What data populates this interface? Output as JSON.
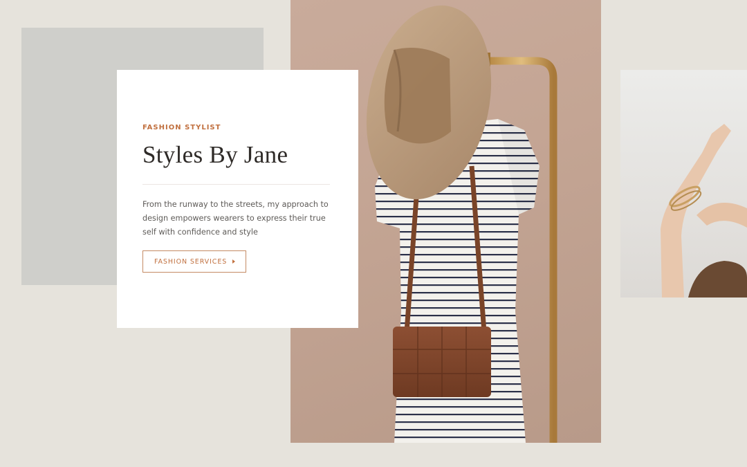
{
  "hero": {
    "eyebrow": "FASHION STYLIST",
    "title": "Styles By Jane",
    "description": "From the runway to the streets, my approach to design empowers wearers to express their true self with confidence and style",
    "cta_label": "FASHION SERVICES"
  },
  "colors": {
    "background": "#e6e3dc",
    "accent": "#c1703f",
    "gray_block": "#cfcfcb",
    "card": "#ffffff"
  },
  "icons": {
    "cta_arrow": "caret-right-icon"
  }
}
